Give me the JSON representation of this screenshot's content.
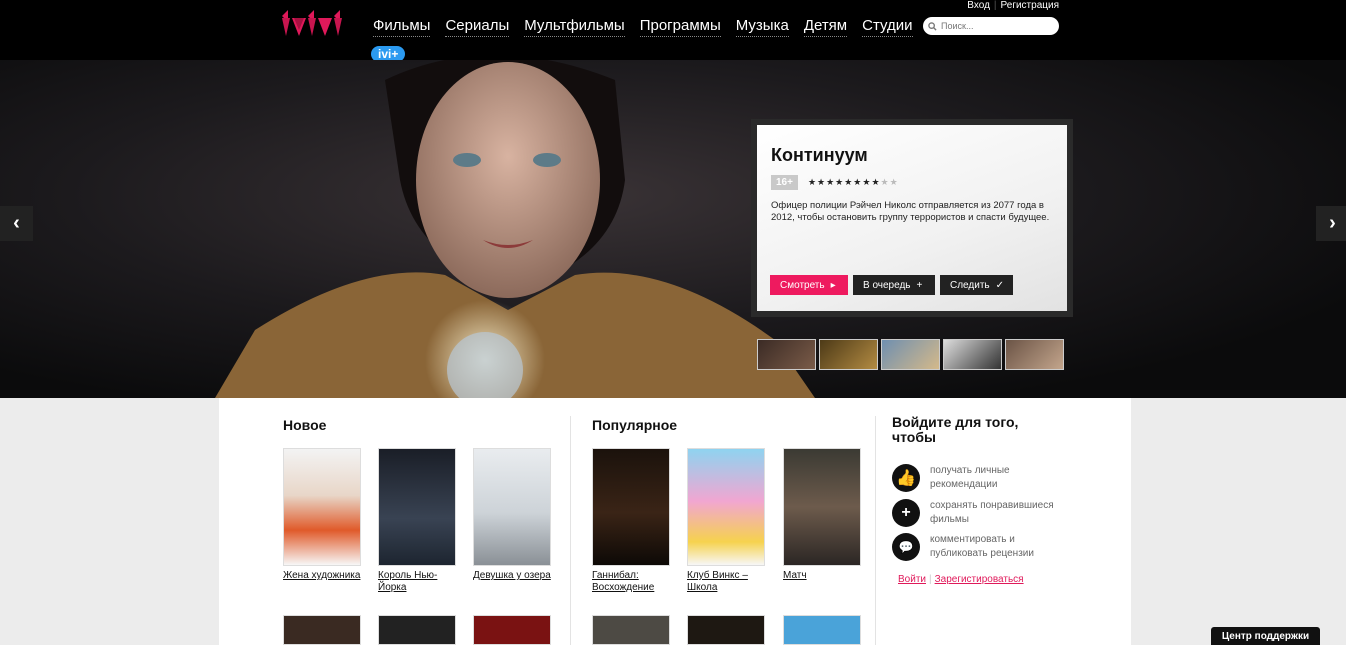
{
  "header": {
    "nav": [
      "Фильмы",
      "Сериалы",
      "Мультфильмы",
      "Программы",
      "Музыка",
      "Детям",
      "Студии"
    ],
    "ivi_plus": "ivi+",
    "login": "Вход",
    "register": "Регистрация",
    "search_placeholder": "Поиск..."
  },
  "promo": {
    "title": "Континуум",
    "age": "16+",
    "rating_stars_filled": 8,
    "rating_stars_total": 10,
    "description": "Офицер полиции Рэйчел Николс отправляется из 2077 года в 2012, чтобы остановить группу террористов и спасти будущее.",
    "watch": "Смотреть",
    "queue": "В очередь",
    "follow": "Следить"
  },
  "sections": {
    "new": {
      "title": "Новое",
      "items": [
        {
          "title": "Жена художника"
        },
        {
          "title": "Король Нью-Йорка"
        },
        {
          "title": "Девушка у озера"
        }
      ]
    },
    "popular": {
      "title": "Популярное",
      "items": [
        {
          "title": "Ганнибал: Восхождение"
        },
        {
          "title": "Клуб Винкс – Школа"
        },
        {
          "title": "Матч"
        }
      ]
    },
    "login": {
      "title": "Войдите для того, чтобы",
      "items": [
        {
          "text": "получать личные рекомендации"
        },
        {
          "text": "сохранять понравившиеся фильмы"
        },
        {
          "text": "комментировать и публиковать рецензии"
        }
      ],
      "login_link": "Войти",
      "register_link": "Зарегистироваться"
    }
  },
  "support": "Центр поддержки",
  "colors": {
    "accent": "#ee1a5f",
    "ivi_plus": "#2b9af0"
  }
}
